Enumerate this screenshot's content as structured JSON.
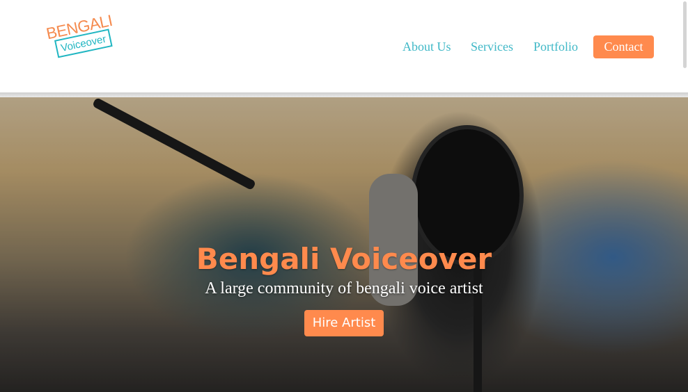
{
  "brand": {
    "logo_line1": "BENGALI",
    "logo_line2": "Voiceover"
  },
  "nav": {
    "about": "About Us",
    "services": "Services",
    "portfolio": "Portfolio",
    "contact": "Contact"
  },
  "hero": {
    "title": "Bengali Voiceover",
    "subtitle": "A large community of bengali voice artist",
    "cta": "Hire Artist"
  },
  "colors": {
    "accent": "#ff8a4d",
    "link": "#3fb8c7",
    "logo_teal": "#21b6c2"
  }
}
